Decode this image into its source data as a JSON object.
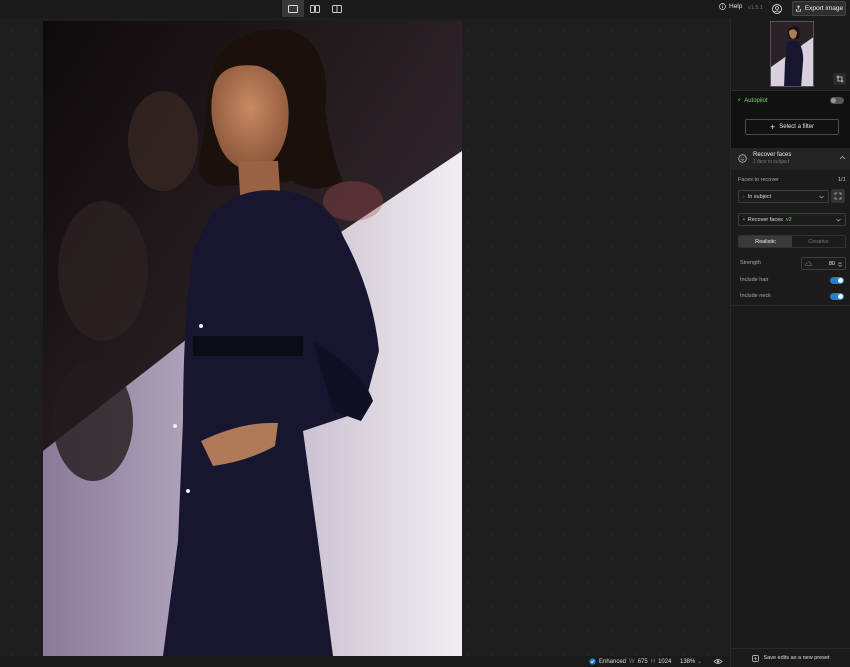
{
  "topbar": {
    "help_label": "Help",
    "version": "v1.5.1",
    "export_label": "Export image"
  },
  "canvas": {
    "status_label": "Enhanced",
    "width_prefix": "W",
    "width_value": "675",
    "height_prefix": "H",
    "height_value": "1024",
    "zoom": "138%"
  },
  "panel": {
    "autopilot_label": "Autopilot",
    "autopilot_enabled": false,
    "select_filter_label": "Select a filter",
    "recover_faces": {
      "title": "Recover faces",
      "subtitle": "1 face in subject",
      "faces_label": "Faces to recover",
      "faces_count": "1/1",
      "subject_option": "In subject",
      "model_label": "Recover faces",
      "model_version": "v2",
      "modes": [
        "Realistic",
        "Creative"
      ],
      "active_mode": "Realistic",
      "strength_label": "Strength",
      "strength_value": "80",
      "include_hair_label": "Include hair",
      "include_hair": true,
      "include_neck_label": "Include neck",
      "include_neck": true
    },
    "save_preset_label": "Save edits as a new preset"
  },
  "colors": {
    "accent_green": "#7bd66e",
    "toggle_blue": "#1e7fd6",
    "background": "#1c1c1c"
  }
}
